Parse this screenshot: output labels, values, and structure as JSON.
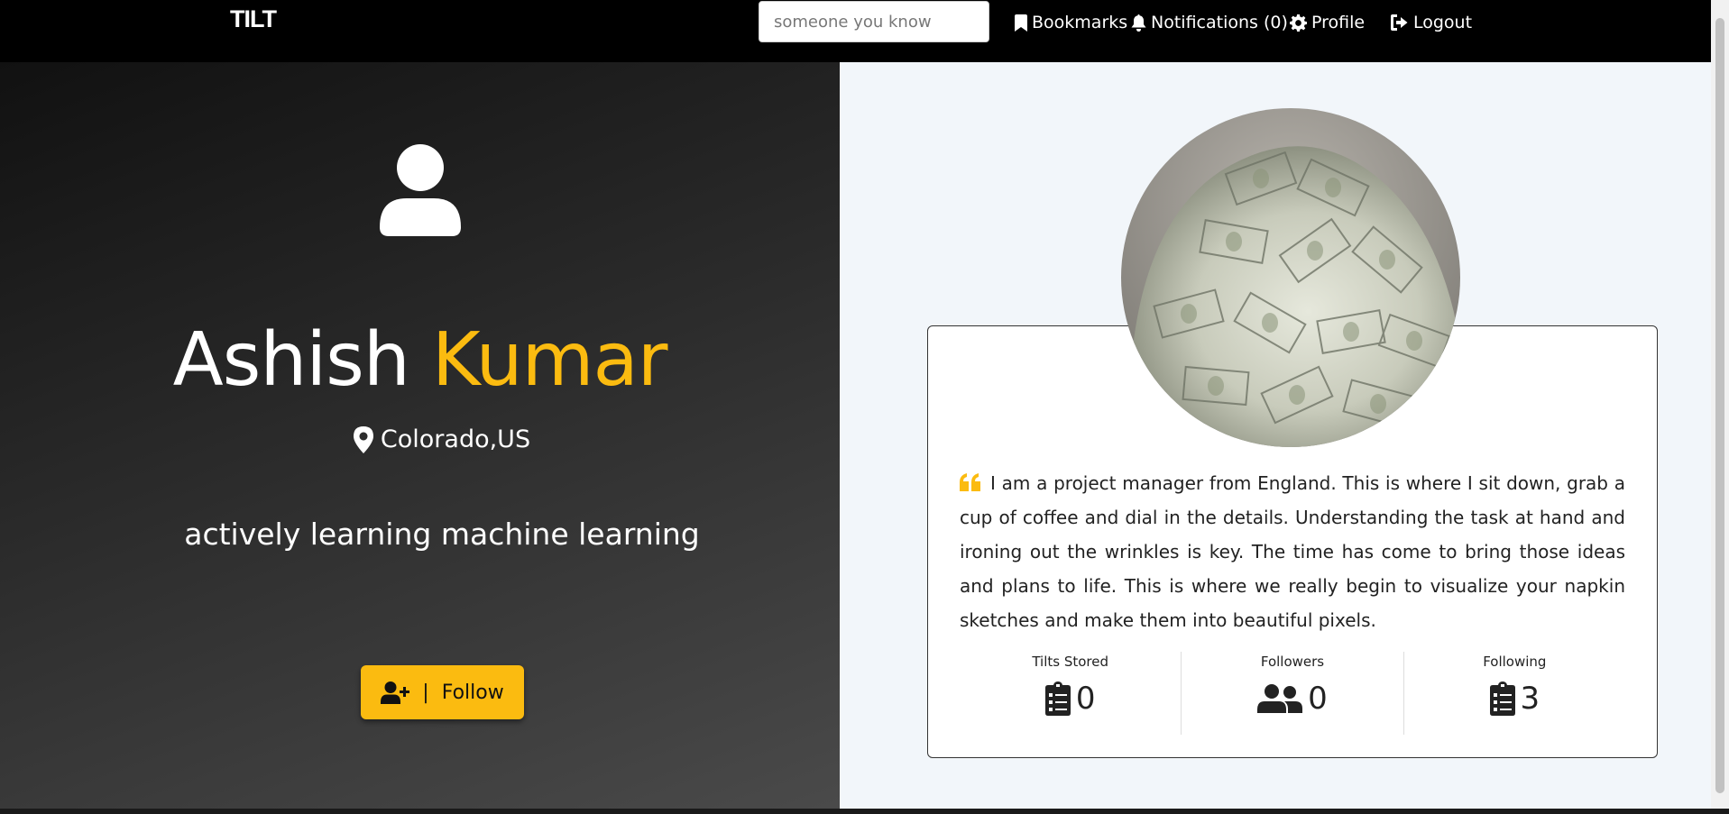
{
  "nav": {
    "brand": "TILT",
    "search_placeholder": "someone you know",
    "bookmarks": "Bookmarks",
    "notifications": "Notifications (0)",
    "profile": "Profile",
    "logout": "Logout"
  },
  "profile": {
    "first_name": "Ashish",
    "last_name": "Kumar",
    "location": "Colorado,US",
    "tagline": "actively learning machine learning",
    "follow_label": "Follow",
    "follow_separator": "|",
    "bio": "I am a project manager from England. This is where I sit down, grab a cup of coffee and dial in the details. Understanding the task at hand and ironing out the wrinkles is key. The time has come to bring those ideas and plans to life. This is where we really begin to visualize your napkin sketches and make them into beautiful pixels."
  },
  "stats": [
    {
      "label": "Tilts Stored",
      "value": "0",
      "icon": "clipboard-list-icon"
    },
    {
      "label": "Followers",
      "value": "0",
      "icon": "users-icon"
    },
    {
      "label": "Following",
      "value": "3",
      "icon": "clipboard-list-icon"
    }
  ],
  "colors": {
    "accent": "#fbbb10",
    "navbar": "#000000",
    "page_background": "#f2f6fa"
  }
}
